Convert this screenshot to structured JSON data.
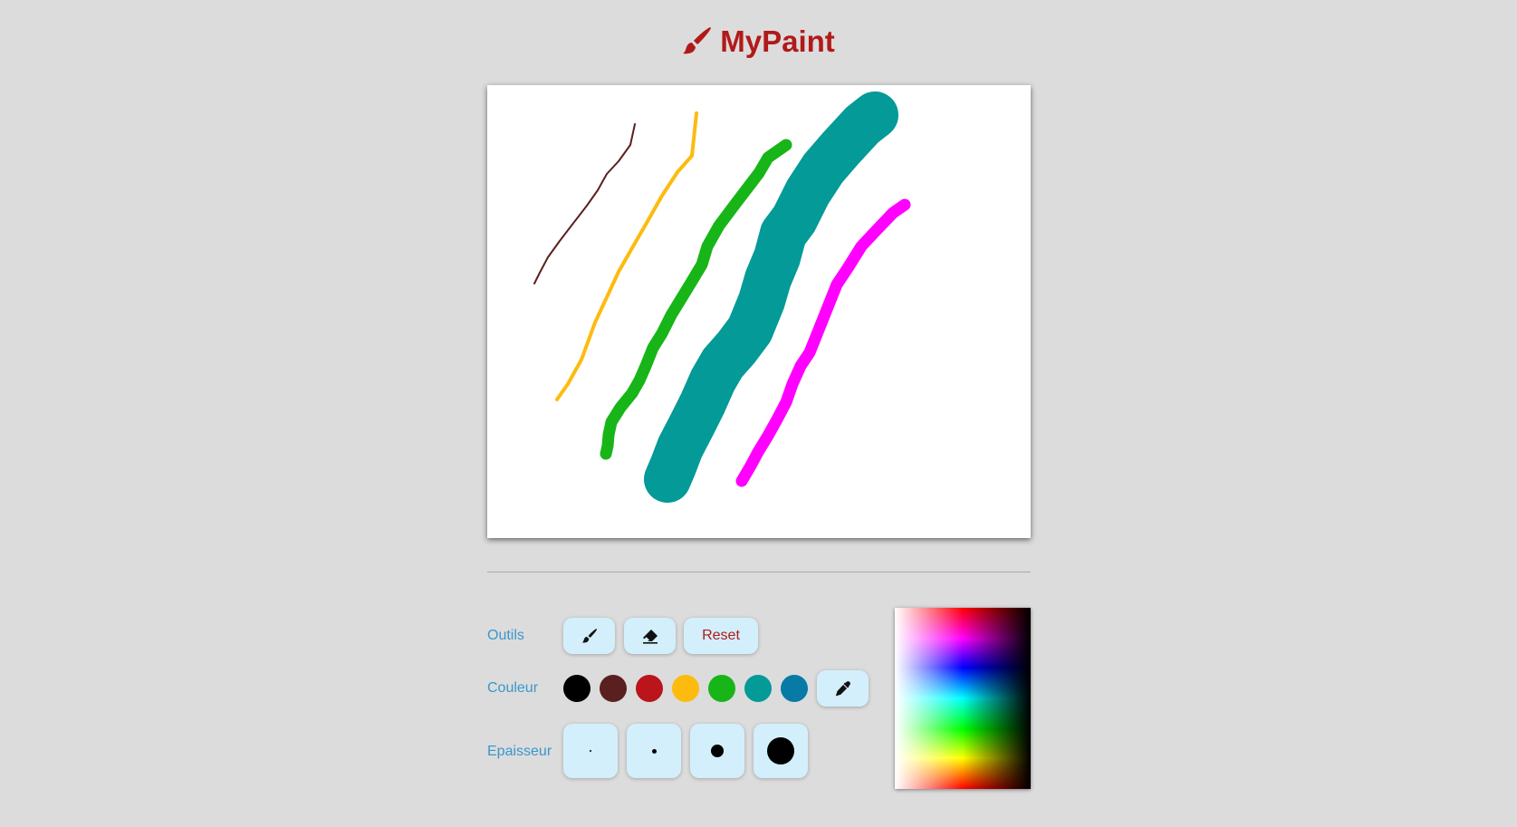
{
  "app": {
    "title": "MyPaint",
    "title_color": "#b11a1a",
    "icon": "paint-brush-icon"
  },
  "toolbar": {
    "tools_label": "Outils",
    "color_label": "Couleur",
    "thickness_label": "Epaisseur",
    "brush_icon": "brush-icon",
    "eraser_icon": "eraser-icon",
    "reset_label": "Reset",
    "eyedropper_icon": "eyedropper-icon"
  },
  "colors": [
    "#000000",
    "#5a2020",
    "#b9151b",
    "#fdbb0f",
    "#17b517",
    "#039a98",
    "#087aa6"
  ],
  "thicknesses": [
    "thin",
    "small",
    "medium",
    "large"
  ],
  "theme": {
    "background": "#dcdcdc",
    "label_color": "#3a97cc",
    "button_bg": "#d3effb"
  },
  "canvas": {
    "strokes": [
      {
        "color": "#5a2020"
      },
      {
        "color": "#fdbb0f"
      },
      {
        "color": "#17b517"
      },
      {
        "color": "#039a98"
      },
      {
        "color": "#ff00ff"
      }
    ]
  }
}
